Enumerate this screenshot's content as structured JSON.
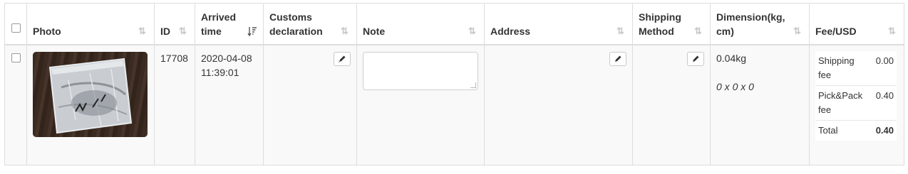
{
  "columns": {
    "photo": "Photo",
    "id": "ID",
    "arrived_time_line1": "Arrived",
    "arrived_time_line2": "time",
    "customs_line1": "Customs",
    "customs_line2": "declaration",
    "note": "Note",
    "address": "Address",
    "shipping_line1": "Shipping",
    "shipping_line2": "Method",
    "dimension_line1": "Dimension(kg,",
    "dimension_line2": "cm)",
    "fee": "Fee/USD"
  },
  "sort_icons": {
    "default": "sort-icon",
    "arrived_time": "sort-descending-icon"
  },
  "rows": [
    {
      "checked": false,
      "photo_alt": "",
      "id": "17708",
      "arrived_date": "2020-04-08",
      "arrived_clock": "11:39:01",
      "customs_declaration": "",
      "note": "",
      "address": "",
      "shipping_method": "",
      "weight": "0.04kg",
      "size": "0 x 0 x 0",
      "fees": [
        {
          "label_line1": "Shipping",
          "label_line2": "fee",
          "amount": "0.00"
        },
        {
          "label_line1": "Pick&Pack",
          "label_line2": "fee",
          "amount": "0.40"
        }
      ],
      "total_label": "Total",
      "total_amount": "0.40"
    }
  ]
}
